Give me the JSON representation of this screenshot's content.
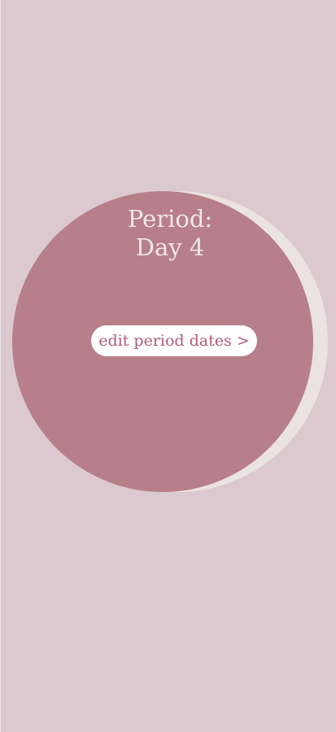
{
  "period": {
    "label": "Period:",
    "day_text": "Day 4"
  },
  "actions": {
    "edit_period_dates_label": "edit period dates >"
  },
  "colors": {
    "background": "#dbc9cf",
    "disc": "#b77f8a",
    "crescent": "#ebe3e1",
    "title_text": "#f1e6e9",
    "button_bg": "#ffffff",
    "button_text": "#b15a72"
  }
}
